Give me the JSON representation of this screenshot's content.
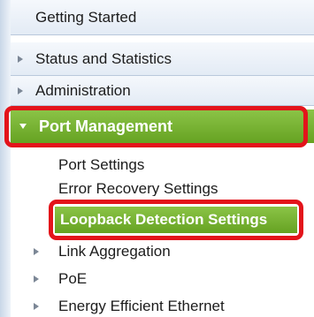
{
  "nav": {
    "items": [
      {
        "label": "Getting Started",
        "expandable": false
      },
      {
        "label": "Status and Statistics",
        "expandable": true
      },
      {
        "label": "Administration",
        "expandable": true
      },
      {
        "label": "Port Management",
        "expandable": true,
        "expanded": true,
        "active": true,
        "children": [
          {
            "label": "Port Settings"
          },
          {
            "label": "Error Recovery Settings"
          },
          {
            "label": "Loopback Detection Settings",
            "selected": true
          },
          {
            "label": "Link Aggregation",
            "expandable": true
          },
          {
            "label": "PoE",
            "expandable": true
          },
          {
            "label": "Energy Efficient Ethernet",
            "expandable": true
          }
        ]
      }
    ]
  },
  "colors": {
    "active_green": "#7ab637",
    "highlight_red": "#e3141b",
    "header_bg": "#e9eff7"
  }
}
